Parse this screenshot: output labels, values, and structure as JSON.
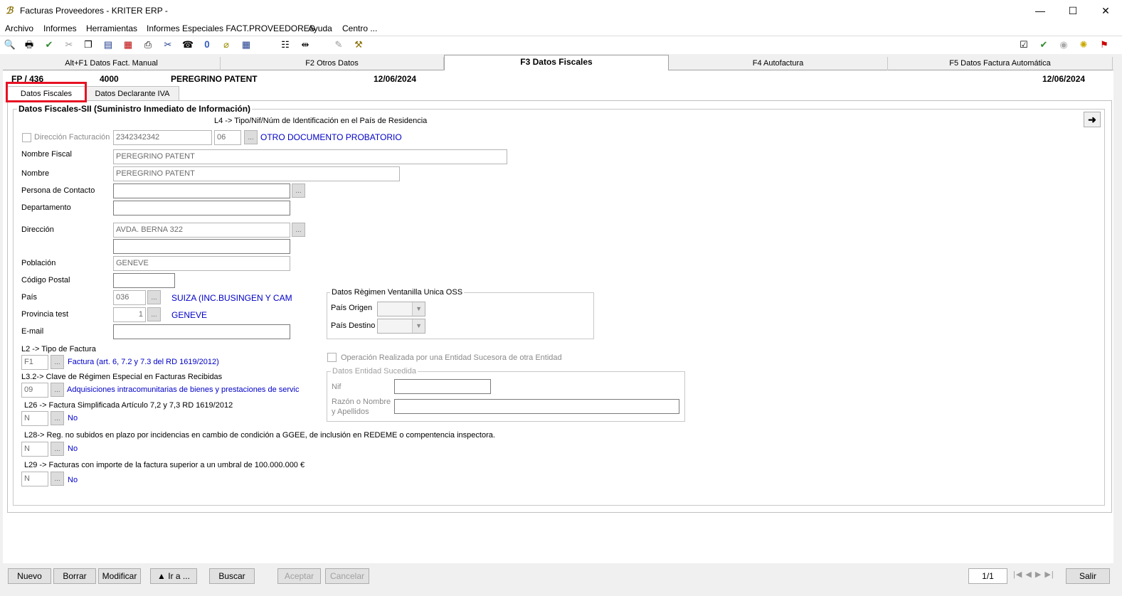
{
  "window": {
    "title": "Facturas Proveedores  - KRITER ERP -",
    "minimize": "—",
    "maximize": "☐",
    "close": "✕"
  },
  "menu": [
    "Archivo",
    "Informes",
    "Herramientas",
    "Informes Especiales FACT.PROVEEDORES",
    "Ayuda",
    "Centro ..."
  ],
  "tabs": [
    {
      "label": "Alt+F1 Datos Fact. Manual"
    },
    {
      "label": "F2 Otros Datos"
    },
    {
      "label": "F3 Datos Fiscales",
      "active": true
    },
    {
      "label": "F4 Autofactura"
    },
    {
      "label": "F5 Datos Factura Automática"
    }
  ],
  "record": {
    "doc": "FP / 436",
    "code": "4000",
    "name": "PEREGRINO PATENT",
    "date": "12/06/2024",
    "date_right": "12/06/2024"
  },
  "subtabs": [
    "Datos Fiscales",
    "Datos Declarante IVA"
  ],
  "section_title": "Datos Fiscales-SII (Suministro Inmediato de Información)",
  "l4_label": "L4 -> Tipo/Nif/Núm de Identificación en el País de Residencia",
  "form": {
    "dir_fact_label": "Dirección Facturación",
    "nif": "2342342342",
    "tipo": "06",
    "tipo_desc": "OTRO DOCUMENTO PROBATORIO",
    "nombre_fiscal_label": "Nombre Fiscal",
    "nombre_fiscal": "PEREGRINO PATENT",
    "nombre_label": "Nombre",
    "nombre": "PEREGRINO PATENT",
    "contacto_label": "Persona de Contacto",
    "contacto": "",
    "depto_label": "Departamento",
    "depto": "",
    "direccion_label": "Dirección",
    "direccion": "AVDA. BERNA 322",
    "direccion2": "",
    "poblacion_label": "Población",
    "poblacion": "GENEVE",
    "cp_label": "Código Postal",
    "cp": "",
    "pais_label": "País",
    "pais": "036",
    "pais_desc": "SUIZA (INC.BUSINGEN Y CAM",
    "provincia_label": "Provincia test",
    "provincia": "1",
    "provincia_desc": "GENEVE",
    "email_label": "E-mail",
    "email": "",
    "l2_label": "L2 -> Tipo de Factura",
    "l2_val": "F1",
    "l2_desc": "Factura (art. 6, 7.2 y 7.3 del RD 1619/2012)",
    "l32_label": "L3.2-> Clave de Régimen Especial en Facturas Recibidas",
    "l32_val": "09",
    "l32_desc": "Adquisiciones intracomunitarias de bienes y prestaciones de servic",
    "l26_label": "L26 -> Factura Simplificada Artículo 7,2 y 7,3 RD 1619/2012",
    "l26_val": "N",
    "l26_desc": "No",
    "l28_label": "L28-> Reg. no subidos en plazo por incidencias en cambio de condición a GGEE, de inclusión en REDEME o compentencia inspectora.",
    "l28_val": "N",
    "l28_desc": "No",
    "l29_label": "L29 -> Facturas con importe de la factura superior a un umbral de 100.000.000 €",
    "l29_val": "N",
    "l29_desc": "No"
  },
  "oss": {
    "title": "Datos Règimen Ventanilla Unica OSS",
    "origen_label": "País Origen",
    "destino_label": "País Destino"
  },
  "sucesora": {
    "check_label": "Operación Realizada por una Entidad Sucesora de otra Entidad",
    "group_title": "Datos Entidad Sucedida",
    "nif_label": "Nif",
    "razon_label1": "Razón o Nombre",
    "razon_label2": "y Apellidos"
  },
  "buttons": {
    "nuevo": "Nuevo",
    "borrar": "Borrar",
    "modificar": "Modificar",
    "ira": "▲ Ir a ...",
    "buscar": "Buscar",
    "aceptar": "Aceptar",
    "cancelar": "Cancelar",
    "salir": "Salir"
  },
  "pager": {
    "position": "1/1",
    "nav": "|◀ ◀ ▶ ▶|"
  }
}
